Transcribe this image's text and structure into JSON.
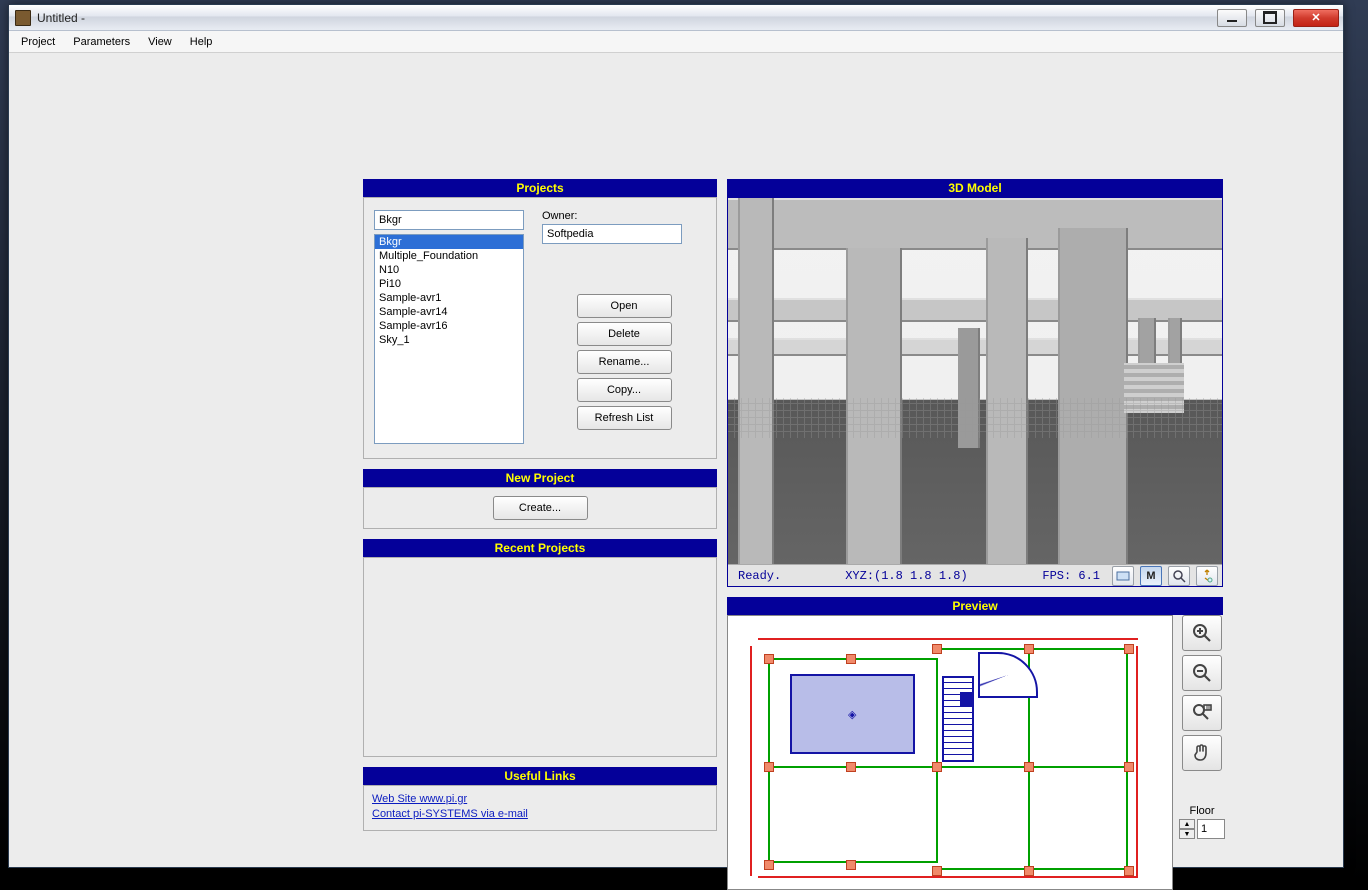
{
  "window": {
    "title": "Untitled -"
  },
  "menubar": [
    "Project",
    "Parameters",
    "View",
    "Help"
  ],
  "sections": {
    "projects": "Projects",
    "new_project": "New Project",
    "recent": "Recent Projects",
    "links": "Useful Links",
    "model3d": "3D Model",
    "preview": "Preview"
  },
  "projects_panel": {
    "input_value": "Bkgr",
    "list": [
      "Bkgr",
      "Multiple_Foundation",
      "N10",
      "Pi10",
      "Sample-avr1",
      "Sample-avr14",
      "Sample-avr16",
      "Sky_1"
    ],
    "selected_index": 0,
    "owner_label": "Owner:",
    "owner_value": "Softpedia",
    "buttons": {
      "open": "Open",
      "delete": "Delete",
      "rename": "Rename...",
      "copy": "Copy...",
      "refresh": "Refresh List"
    }
  },
  "new_project": {
    "create_label": "Create..."
  },
  "links": {
    "website": "Web Site www.pi.gr",
    "contact": "Contact pi-SYSTEMS via e-mail"
  },
  "viewport3d": {
    "status_ready": "Ready.",
    "status_xyz": "XYZ:(1.8 1.8 1.8)",
    "status_fps": "FPS: 6.1",
    "toolbar_M": "M"
  },
  "preview_panel": {
    "floor_label": "Floor",
    "floor_value": "1"
  }
}
